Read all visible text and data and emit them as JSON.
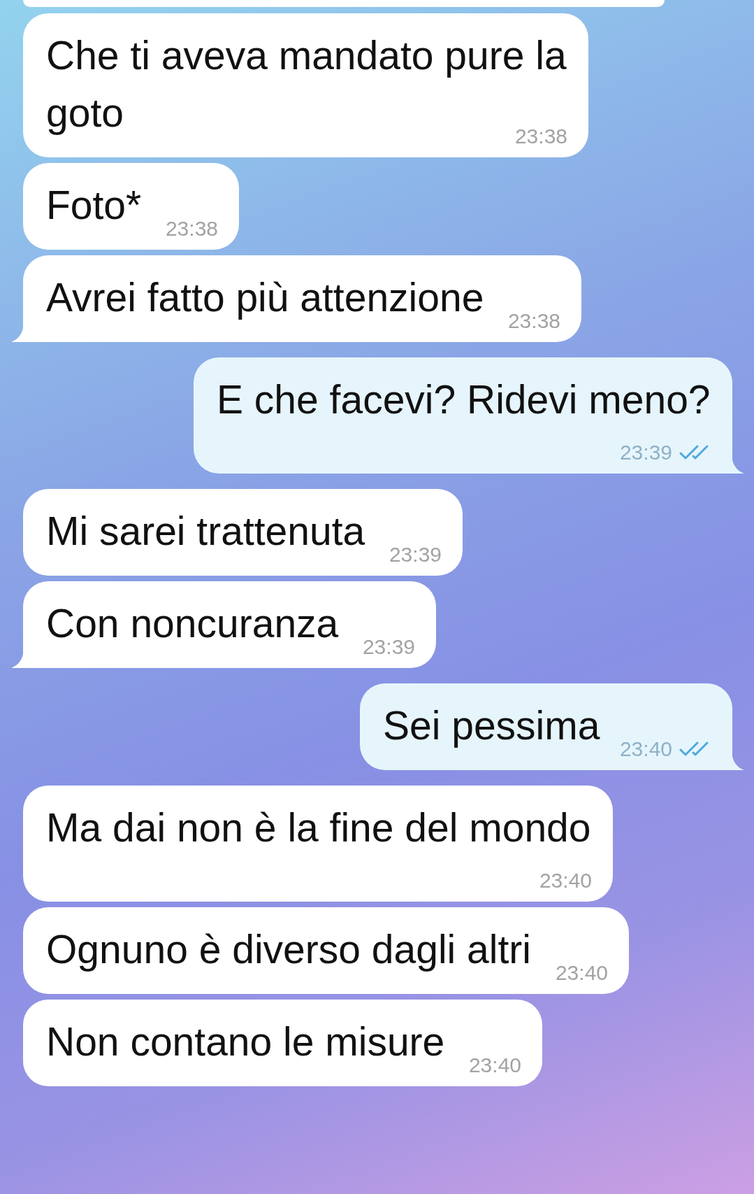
{
  "messages": [
    {
      "text": "Che ti aveva mandato pure la goto",
      "time": "23:38",
      "outgoing": false,
      "tail": false
    },
    {
      "text": "Foto*",
      "time": "23:38",
      "outgoing": false,
      "tail": false
    },
    {
      "text": "Avrei fatto più attenzione",
      "time": "23:38",
      "outgoing": false,
      "tail": true
    },
    {
      "text": "E che facevi? Ridevi meno?",
      "time": "23:39",
      "outgoing": true,
      "tail": true,
      "read": true
    },
    {
      "text": "Mi sarei trattenuta",
      "time": "23:39",
      "outgoing": false,
      "tail": false
    },
    {
      "text": "Con noncuranza",
      "time": "23:39",
      "outgoing": false,
      "tail": true
    },
    {
      "text": "Sei pessima",
      "time": "23:40",
      "outgoing": true,
      "tail": true,
      "read": true
    },
    {
      "text": "Ma dai non è la fine del mondo",
      "time": "23:40",
      "outgoing": false,
      "tail": false
    },
    {
      "text": "Ognuno è diverso dagli altri",
      "time": "23:40",
      "outgoing": false,
      "tail": false
    },
    {
      "text": "Non contano le misure",
      "time": "23:40",
      "outgoing": false,
      "tail": false
    }
  ]
}
